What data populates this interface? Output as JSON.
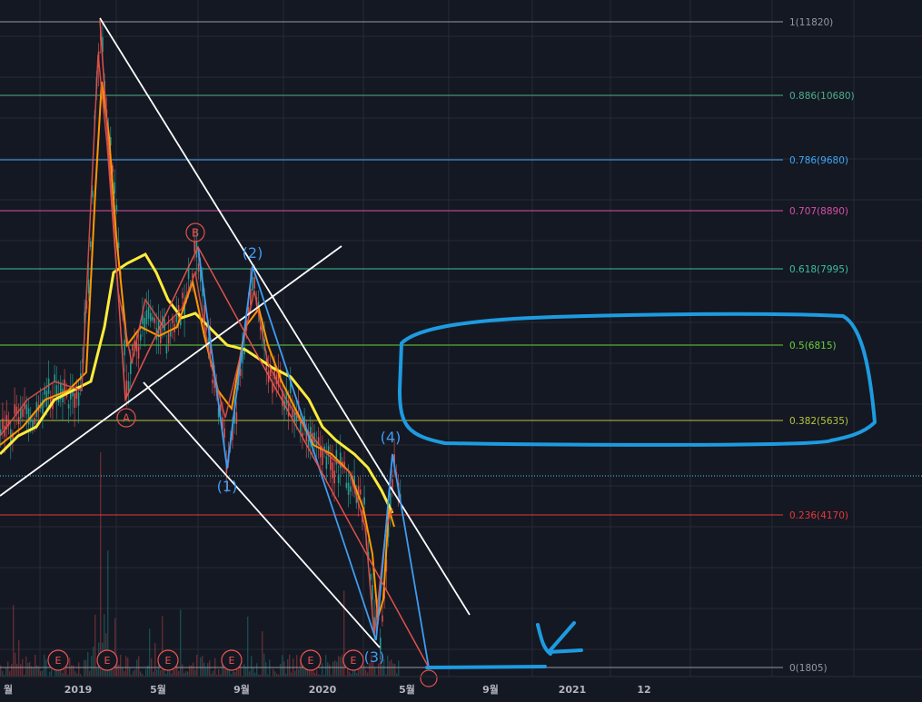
{
  "chart_data": {
    "type": "line",
    "x_axis_labels": [
      "월",
      "2019",
      "5월",
      "9월",
      "2020",
      "5월",
      "9월",
      "2021",
      "12"
    ],
    "fib_levels": [
      {
        "label": "1(11820)",
        "color": "#9598a1"
      },
      {
        "label": "0.886(10680)",
        "color": "#4caf8a"
      },
      {
        "label": "0.786(9680)",
        "color": "#42a5f5"
      },
      {
        "label": "0.707(8890)",
        "color": "#d84fa4"
      },
      {
        "label": "0.618(7995)",
        "color": "#3bbf9a"
      },
      {
        "label": "0.5(6815)",
        "color": "#6ccf3a"
      },
      {
        "label": "0.382(5635)",
        "color": "#b5c43a"
      },
      {
        "label": "0.236(4170)",
        "color": "#e53935"
      },
      {
        "label": "0(1805)",
        "color": "#9598a1"
      }
    ],
    "wave_labels": [
      "(1)",
      "(2)",
      "(3)",
      "(4)"
    ],
    "corrective_labels": [
      "A",
      "B"
    ],
    "earnings_badge": "E",
    "colors": {
      "background": "#141823",
      "grid": "#252a36",
      "ma_fast": "#ff9800",
      "ma_slow": "#ffeb3b",
      "wave_line": "#3f9cf0",
      "abc_line": "#e0524a",
      "channel": "#ffffff",
      "annotation": "#1e9be0",
      "current_price_line": "#4dd0e1",
      "candle_up": "#26a69a",
      "candle_down": "#ef5350"
    }
  }
}
